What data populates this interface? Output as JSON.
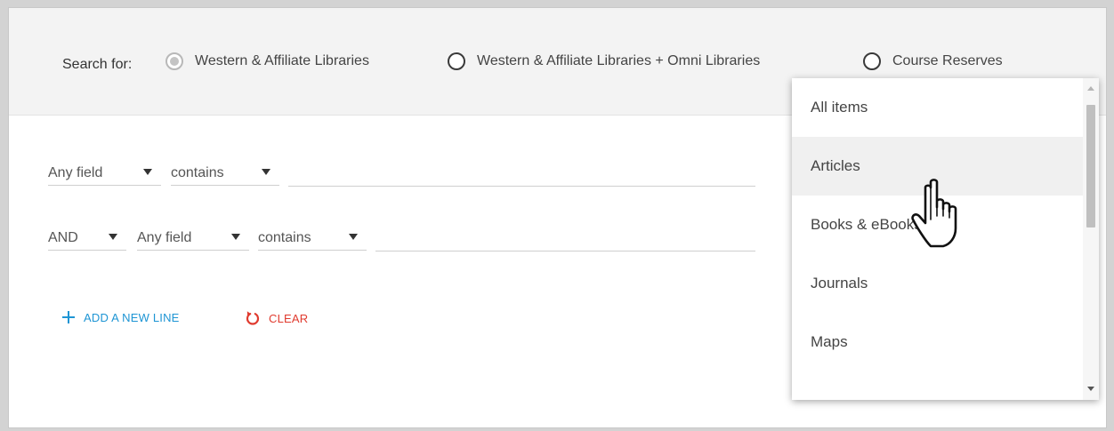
{
  "scope": {
    "label": "Search for:",
    "options": [
      {
        "label": "Western & Affiliate Libraries",
        "checked": true
      },
      {
        "label": "Western & Affiliate Libraries + Omni Libraries",
        "checked": false
      },
      {
        "label": "Course Reserves",
        "checked": false
      }
    ]
  },
  "rows": [
    {
      "field": "Any field",
      "condition": "contains",
      "value": ""
    },
    {
      "operator": "AND",
      "field": "Any field",
      "condition": "contains",
      "value": ""
    }
  ],
  "actions": {
    "add_line": "ADD A NEW LINE",
    "clear": "CLEAR"
  },
  "dropdown": {
    "items": [
      "All items",
      "Articles",
      "Books & eBooks",
      "Journals",
      "Maps"
    ],
    "highlighted": "Articles"
  },
  "colors": {
    "add_accent": "#1e95d4",
    "clear_accent": "#e03b2f"
  },
  "icons": {
    "add": "plus-icon",
    "clear": "refresh-icon",
    "cursor": "hand-pointer-icon"
  }
}
